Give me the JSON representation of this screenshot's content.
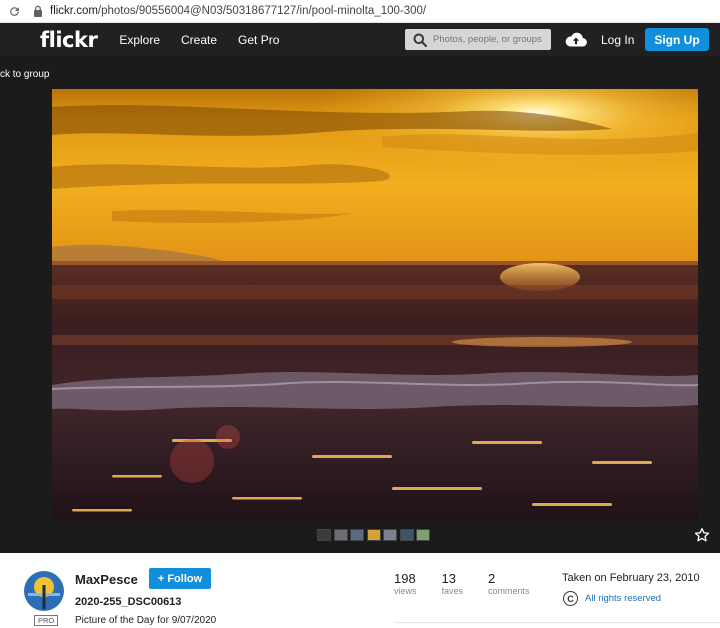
{
  "browser": {
    "url_host": "flickr.com",
    "url_path": "/photos/90556004@N03/50318677127/in/pool-minolta_100-300/"
  },
  "header": {
    "logo": "flickr",
    "nav": [
      "Explore",
      "Create",
      "Get Pro"
    ],
    "search_placeholder": "Photos, people, or groups",
    "login": "Log In",
    "signup": "Sign Up"
  },
  "stage": {
    "back_link": "ck to group"
  },
  "photo_info": {
    "author": "MaxPesce",
    "follow_label": "+ Follow",
    "pro_badge": "PRO",
    "title": "2020-255_DSC00613",
    "description": "Picture of the Day for 9/07/2020",
    "stats": [
      {
        "value": "198",
        "label": "views"
      },
      {
        "value": "13",
        "label": "faves"
      },
      {
        "value": "2",
        "label": "comments"
      }
    ],
    "taken": "Taken on February 23, 2010",
    "license": "All rights reserved",
    "license_symbol": "C"
  },
  "icons": {
    "search": "search-icon",
    "upload": "cloud-upload-icon",
    "favorite": "star-icon"
  }
}
